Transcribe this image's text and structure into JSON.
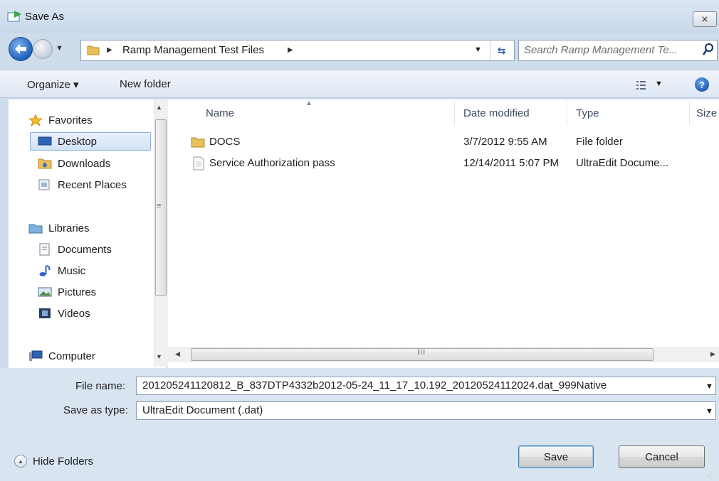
{
  "window": {
    "title": "Save As",
    "close_label": "⨯"
  },
  "address_bar": {
    "path": "Ramp Management Test Files",
    "search_placeholder": "Search Ramp Management Te..."
  },
  "toolbar": {
    "organize_label": "Organize ▾",
    "new_folder_label": "New folder"
  },
  "nav": {
    "favorites_label": "Favorites",
    "favorites": [
      "Desktop",
      "Downloads",
      "Recent Places"
    ],
    "libraries_label": "Libraries",
    "libraries": [
      "Documents",
      "Music",
      "Pictures",
      "Videos"
    ],
    "computer_label": "Computer",
    "selected": "Desktop"
  },
  "file_list": {
    "columns": [
      "Name",
      "Date modified",
      "Type",
      "Size"
    ],
    "rows": [
      {
        "name": "DOCS",
        "date": "3/7/2012 9:55 AM",
        "type": "File folder",
        "icon": "folder-icon"
      },
      {
        "name": "Service Authorization pass",
        "date": "12/14/2011 5:07 PM",
        "type": "UltraEdit Docume...",
        "icon": "document-icon"
      }
    ]
  },
  "form": {
    "file_name_label": "File name:",
    "file_name_value": "201205241120812_B_837DTP4332b2012-05-24_11_17_10.192_20120524112024.dat_999Native",
    "save_type_label": "Save as type:",
    "save_type_value": "UltraEdit Document (.dat)",
    "hide_folders_label": "Hide Folders",
    "save_label": "Save",
    "cancel_label": "Cancel"
  },
  "colors": {
    "chrome": "#cfdcec",
    "accent": "#1e5fb8",
    "selection": "#d2e2f6",
    "folder": "#e9c15a"
  }
}
